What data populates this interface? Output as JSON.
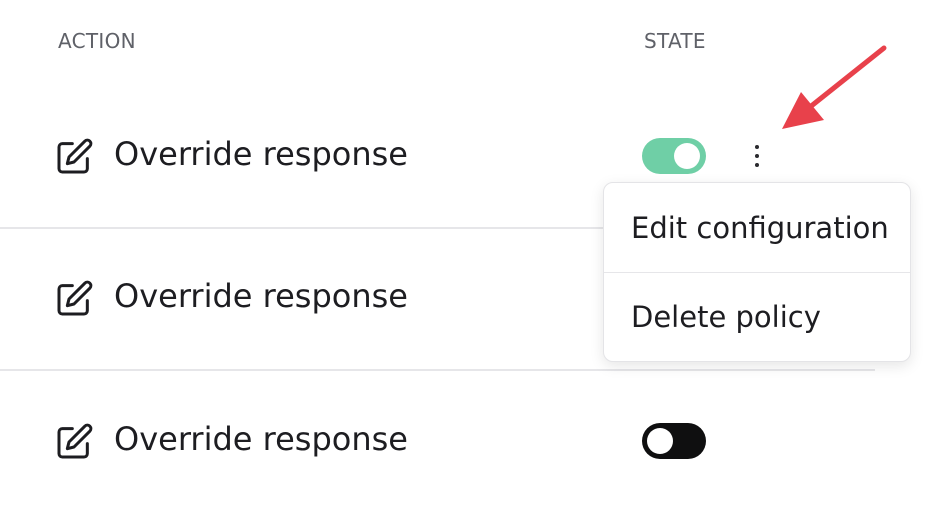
{
  "table": {
    "headers": {
      "action": "ACTION",
      "state": "STATE"
    },
    "rows": [
      {
        "action_label": "Override response",
        "icon": "edit-icon",
        "state": "on"
      },
      {
        "action_label": "Override response",
        "icon": "edit-icon",
        "state": "hidden-by-menu"
      },
      {
        "action_label": "Override response",
        "icon": "edit-icon",
        "state": "off"
      }
    ]
  },
  "menu": {
    "items": [
      {
        "label": "Edit configuration"
      },
      {
        "label": "Delete policy"
      }
    ]
  },
  "colors": {
    "toggle_on": "#6fcfa6",
    "toggle_off": "#0f0f10",
    "annotation_arrow": "#e8414b",
    "header_text": "#5f6168"
  }
}
